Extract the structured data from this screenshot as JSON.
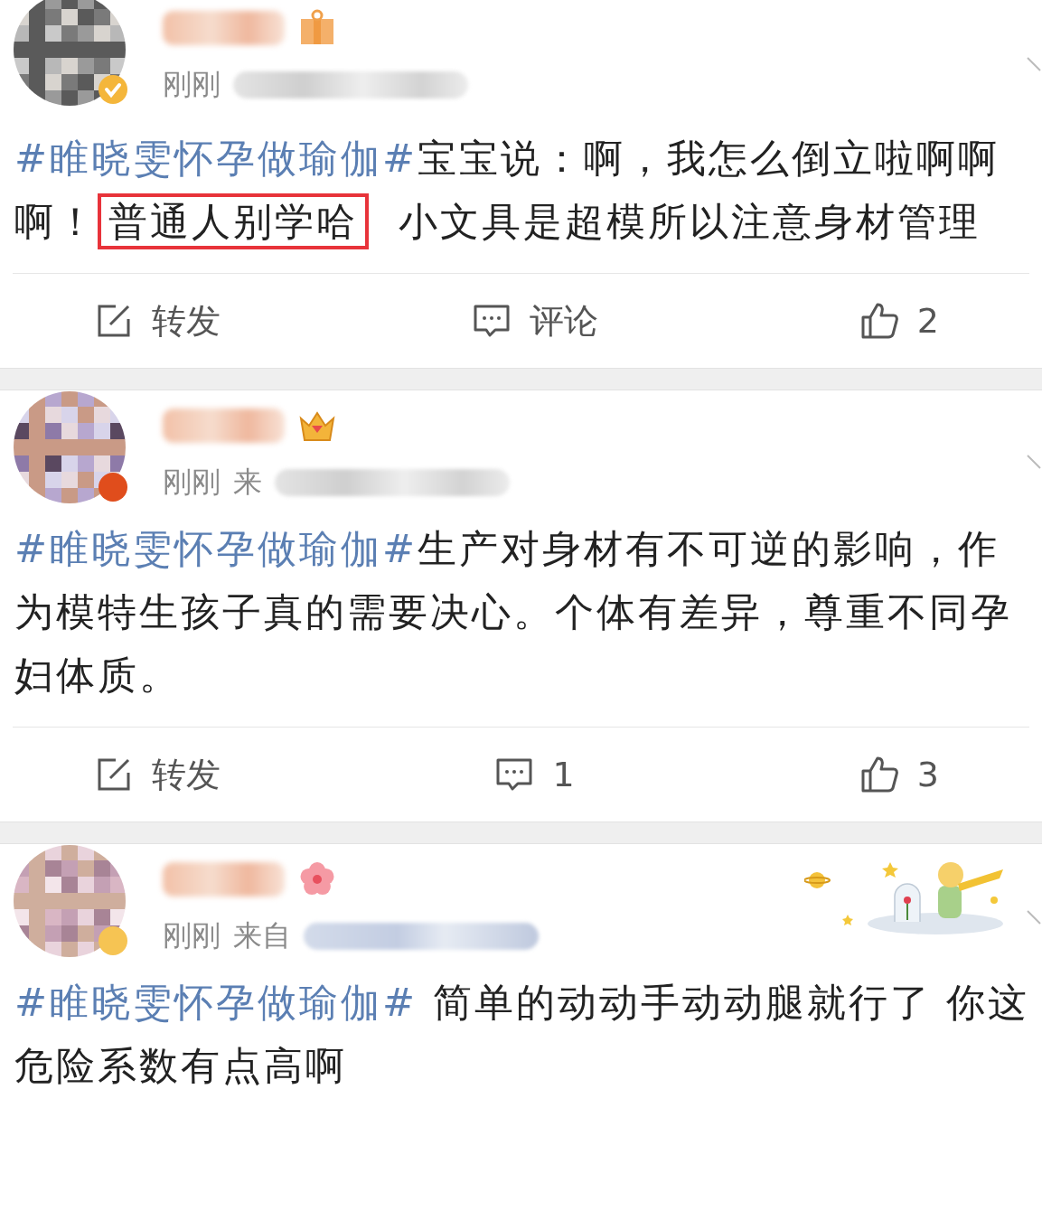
{
  "posts": [
    {
      "avatar_badge": {
        "color": "#f4b63b"
      },
      "name_badge": {
        "kind": "gift"
      },
      "time": "刚刚",
      "body": [
        {
          "kind": "hashtag",
          "text": "#睢晓雯怀孕做瑜伽#"
        },
        {
          "kind": "text",
          "text": "宝宝说：啊，我怎么倒立啦啊啊啊！"
        },
        {
          "kind": "highlight",
          "text": "普通人别学哈"
        },
        {
          "kind": "text",
          "text": "  小文具是超模所以注意身材管理"
        }
      ],
      "actions": [
        {
          "kind": "repost",
          "label": "转发"
        },
        {
          "kind": "comment",
          "label": "评论"
        },
        {
          "kind": "like",
          "label": "2"
        }
      ]
    },
    {
      "avatar_badge": {
        "color": "#e04d1c"
      },
      "name_badge": {
        "kind": "crown"
      },
      "time": "刚刚",
      "source": "来",
      "body": [
        {
          "kind": "hashtag",
          "text": "#睢晓雯怀孕做瑜伽#"
        },
        {
          "kind": "text",
          "text": "生产对身材有不可逆的影响，作为模特生孩子真的需要决心。个体有差异，尊重不同孕妇体质。"
        }
      ],
      "actions": [
        {
          "kind": "repost",
          "label": "转发"
        },
        {
          "kind": "comment",
          "label": "1"
        },
        {
          "kind": "like",
          "label": "3"
        }
      ]
    },
    {
      "avatar_badge": {
        "color": "#f6c453"
      },
      "name_badge": {
        "kind": "flower"
      },
      "time": "刚刚",
      "source": "来自",
      "sticker": {
        "kind": "drawing"
      },
      "body": [
        {
          "kind": "hashtag",
          "text": "#睢晓雯怀孕做瑜伽#"
        },
        {
          "kind": "text",
          "text": " 简单的动动手动动腿就行了 你这危险系数有点高啊"
        }
      ]
    }
  ]
}
